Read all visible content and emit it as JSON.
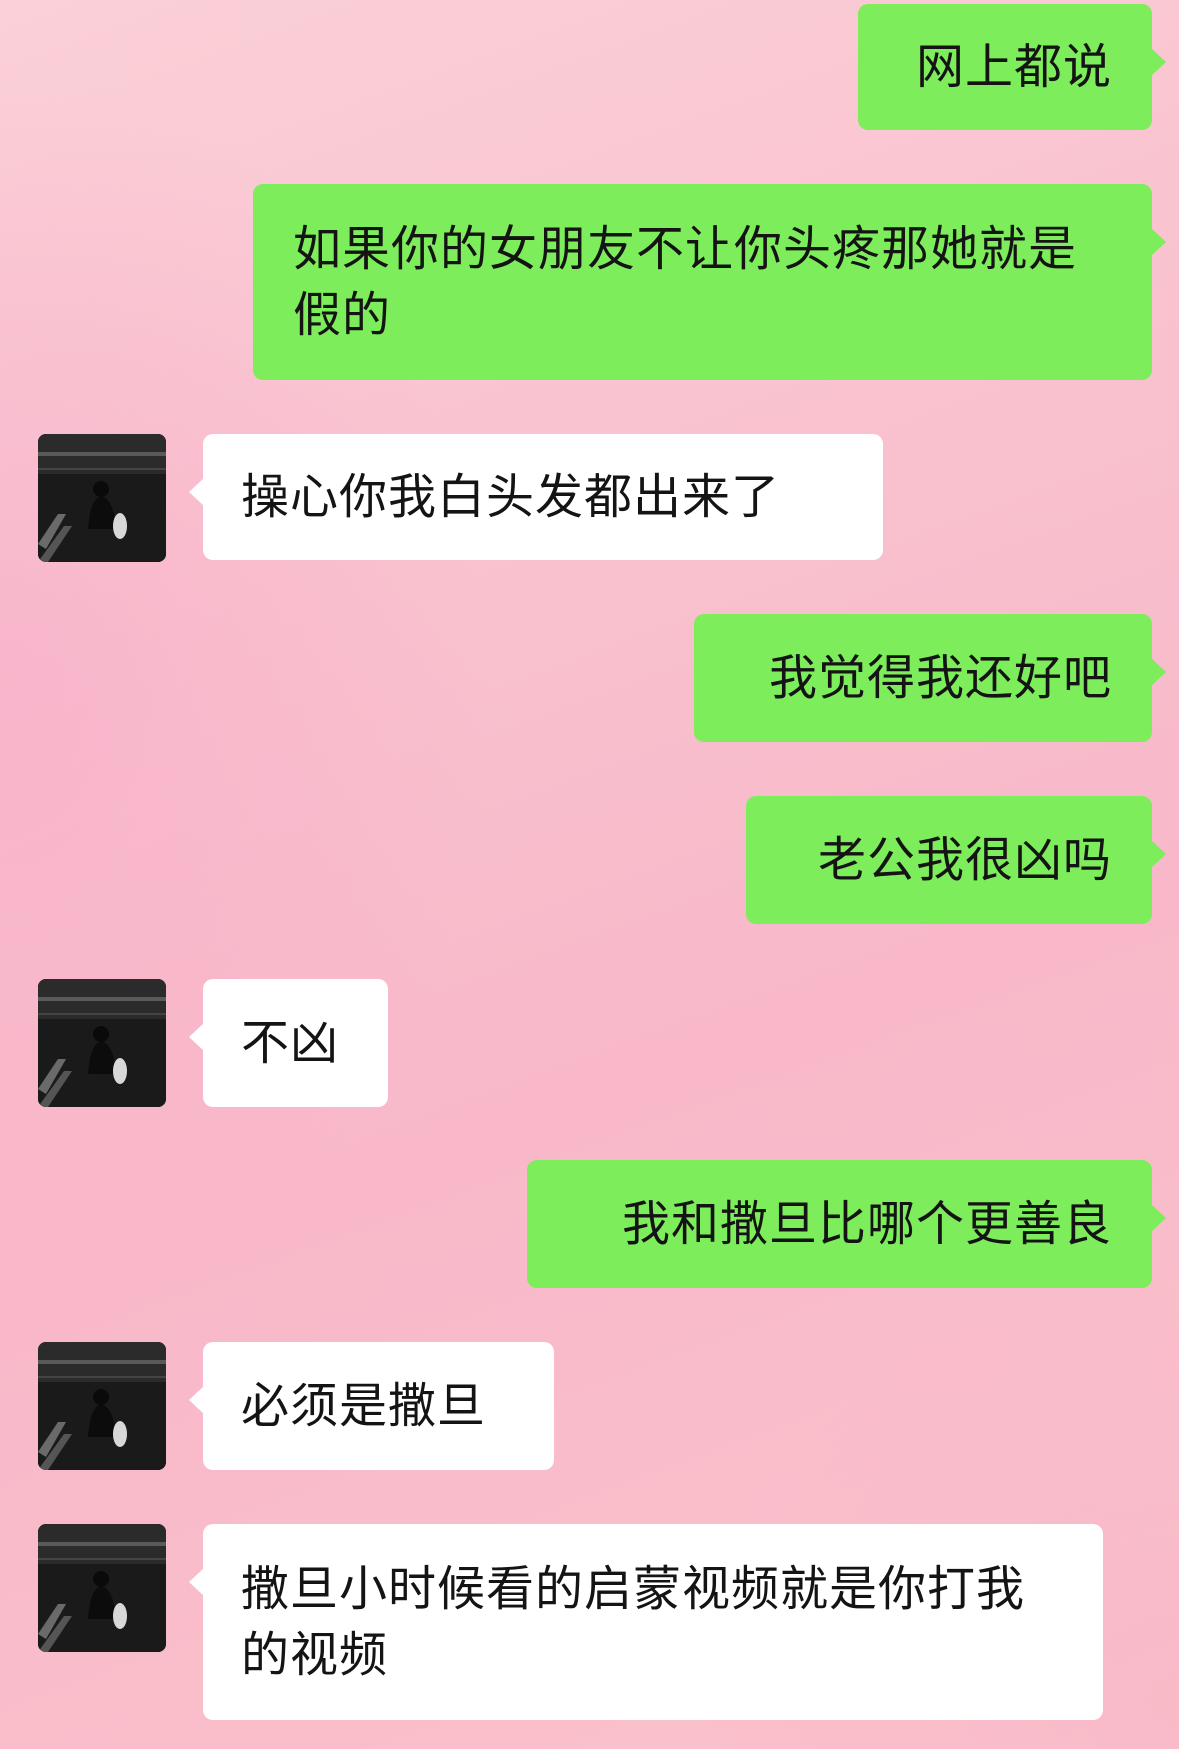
{
  "messages": [
    {
      "side": "sent",
      "text": "网上都说"
    },
    {
      "side": "sent",
      "text": "如果你的女朋友不让你头疼那她就是假的"
    },
    {
      "side": "received",
      "text": "操心你我白头发都出来了",
      "avatar": "avatar-photo"
    },
    {
      "side": "sent",
      "text": "我觉得我还好吧"
    },
    {
      "side": "sent",
      "text": "老公我很凶吗"
    },
    {
      "side": "received",
      "text": "不凶",
      "avatar": "avatar-photo"
    },
    {
      "side": "sent",
      "text": "我和撒旦比哪个更善良"
    },
    {
      "side": "received",
      "text": "必须是撒旦",
      "avatar": "avatar-photo"
    },
    {
      "side": "received",
      "text": "撒旦小时候看的启蒙视频就是你打我的视频",
      "avatar": "avatar-photo"
    }
  ],
  "colors": {
    "sent_bubble": "#7ded5b",
    "received_bubble": "#ffffff",
    "text": "#141414"
  }
}
